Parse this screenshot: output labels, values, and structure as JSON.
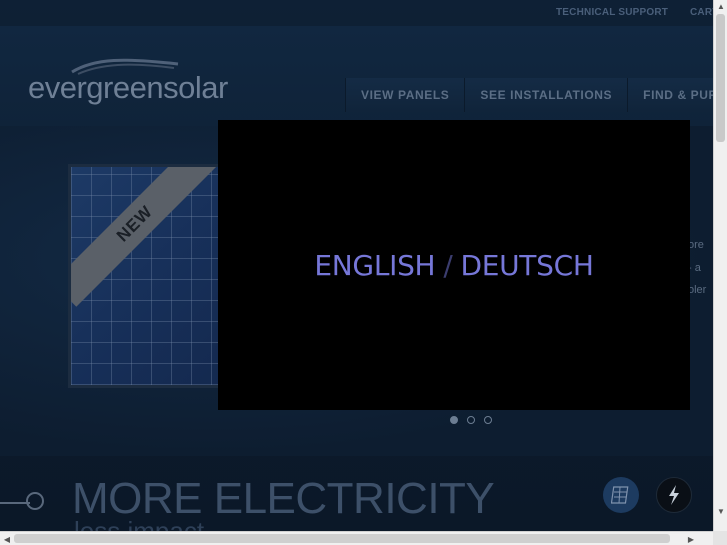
{
  "utility_links": {
    "support": "TECHNICAL SUPPORT",
    "cart": "CART"
  },
  "logo": {
    "text": "evergreensolar"
  },
  "nav": [
    {
      "label": "VIEW PANELS"
    },
    {
      "label": "SEE INSTALLATIONS"
    },
    {
      "label": "FIND & PURCHASE"
    }
  ],
  "hero": {
    "badge": "NEW",
    "side_text": [
      "ore",
      "- a",
      "oler"
    ],
    "slides_total": 3,
    "active_slide": 1
  },
  "language_overlay": {
    "english": "ENGLISH",
    "separator": "/",
    "deutsch": "DEUTSCH"
  },
  "promo": {
    "title": "MORE ELECTRICITY",
    "subtitle": "less impact"
  },
  "colors": {
    "accent_lang": "#7677d8",
    "background": "#0e2035"
  }
}
